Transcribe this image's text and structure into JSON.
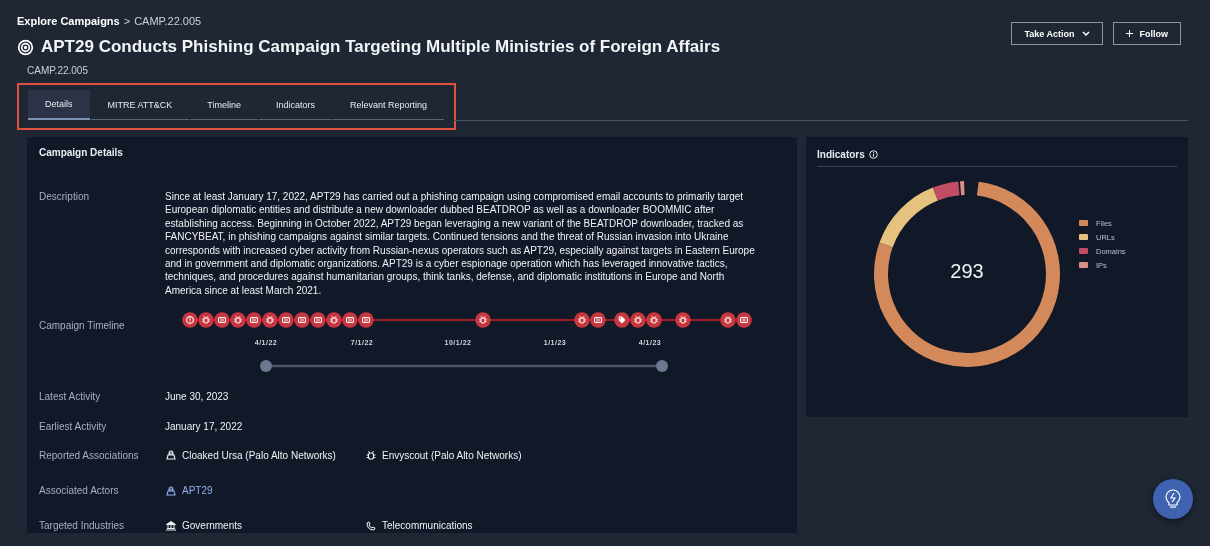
{
  "breadcrumb": {
    "parent": "Explore Campaigns",
    "separator": ">",
    "current": "CAMP.22.005"
  },
  "header": {
    "title": "APT29 Conducts Phishing Campaign Targeting Multiple Ministries of Foreign Affairs",
    "id": "CAMP.22.005",
    "buttons": [
      {
        "kind": "dropdown",
        "label": "Take Action"
      },
      {
        "kind": "add",
        "label": "Follow"
      }
    ]
  },
  "tabs": [
    {
      "label": "Details",
      "selected": true
    },
    {
      "label": "MITRE ATT&CK",
      "selected": false
    },
    {
      "label": "Timeline",
      "selected": false
    },
    {
      "label": "Indicators",
      "selected": false
    },
    {
      "label": "Relevant Reporting",
      "selected": false
    }
  ],
  "details": {
    "title": "Campaign Details",
    "description": {
      "label": "Description",
      "text": "Since at least January 17, 2022, APT29 has carried out a phishing campaign using compromised email accounts to primarily target European diplomatic entities and distribute a new downloader dubbed BEATDROP as well as a downloader BOOMMIC after establishing access. Beginning in October 2022, APT29 began leveraging a new variant of the BEATDROP downloader, tracked as FANCYBEAT, in phishing campaigns against similar targets. Continued tensions and the threat of Russian invasion into Ukraine corresponds with increased cyber activity from Russian-nexus operators such as APT29, especially against targets in Eastern Europe and in government and diplomatic organizations. APT29 is a cyber espionage operation which has leveraged innovative tactics, techniques, and procedures against humanitarian groups, think tanks, defense, and diplomatic institutions in Europe and North America since at least March 2021."
    },
    "timeline": {
      "label": "Campaign Timeline",
      "events": [
        {
          "kind": "alert"
        },
        {
          "kind": "malware"
        },
        {
          "kind": "report"
        },
        {
          "kind": "malware"
        },
        {
          "kind": "report"
        },
        {
          "kind": "malware"
        },
        {
          "kind": "report"
        },
        {
          "kind": "report"
        },
        {
          "kind": "report"
        },
        {
          "kind": "malware"
        },
        {
          "kind": "report"
        },
        {
          "kind": "report"
        },
        {
          "kind": "malware"
        },
        {
          "kind": "malware"
        },
        {
          "kind": "report"
        },
        {
          "kind": "tag"
        },
        {
          "kind": "malware"
        },
        {
          "kind": "malware"
        },
        {
          "kind": "malware"
        },
        {
          "kind": "malware"
        },
        {
          "kind": "report"
        }
      ],
      "ticks": [
        "4/1/22",
        "7/1/22",
        "10/1/22",
        "1/1/23",
        "4/1/23"
      ]
    },
    "rows": [
      {
        "label": "Latest Activity",
        "values": [
          {
            "kind": "plain",
            "text": "June 30, 2023"
          }
        ]
      },
      {
        "label": "Earliest Activity",
        "values": [
          {
            "kind": "plain",
            "text": "January 17, 2022"
          }
        ]
      },
      {
        "label": "Reported Associations",
        "values": [
          {
            "kind": "actor",
            "text": "Cloaked Ursa (Palo Alto Networks)"
          },
          {
            "kind": "malware",
            "text": "Envyscout (Palo Alto Networks)"
          }
        ]
      },
      {
        "label": "Associated Actors",
        "values": [
          {
            "kind": "actor-link",
            "text": "APT29"
          }
        ]
      },
      {
        "label": "Targeted Industries",
        "values": [
          {
            "kind": "government",
            "text": "Governments"
          },
          {
            "kind": "phone",
            "text": "Telecommunications"
          }
        ]
      }
    ]
  },
  "indicators": {
    "title": "Indicators",
    "total": "293",
    "legend": [
      {
        "label": "Files",
        "color": "#d4895a"
      },
      {
        "label": "URLs",
        "color": "#e6c27f"
      },
      {
        "label": "Domains",
        "color": "#c24d62"
      },
      {
        "label": "IPs",
        "color": "#d98e86"
      }
    ]
  }
}
